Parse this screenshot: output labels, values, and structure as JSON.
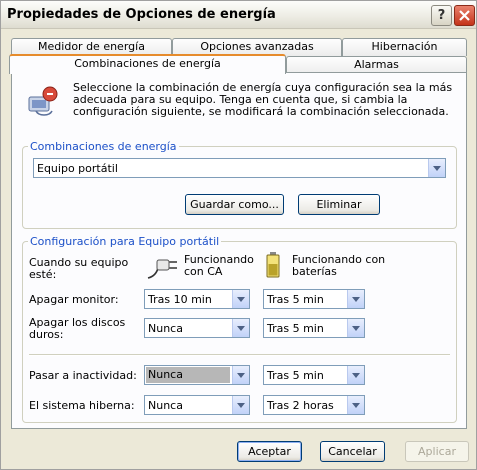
{
  "window": {
    "title": "Propiedades de Opciones de energía",
    "help_label": "?"
  },
  "tabs": {
    "row_top": [
      "Medidor de energía",
      "Opciones avanzadas",
      "Hibernación"
    ],
    "row_bottom": [
      "Combinaciones de energía",
      "Alarmas"
    ],
    "active": "Combinaciones de energía"
  },
  "intro": {
    "icon": "power-schemes-icon",
    "text": "Seleccione la combinación de energía  cuya configuración sea la más adecuada para su equipo. Tenga en cuenta que, si cambia la configuración siguiente, se modificará la combinación seleccionada."
  },
  "schemes": {
    "group_title": "Combinaciones de energía",
    "selected": "Equipo portátil",
    "save_as_label": "Guardar como...",
    "delete_label": "Eliminar"
  },
  "settings": {
    "group_title": "Configuración para Equipo portátil",
    "when_label": "Cuando su equipo esté:",
    "ac_label": "Funcionando con CA",
    "battery_label": "Funcionando con baterías",
    "rows": [
      {
        "label": "Apagar monitor:",
        "ac": "Tras 10 min",
        "battery": "Tras 5 min"
      },
      {
        "label": "Apagar los discos duros:",
        "ac": "Nunca",
        "battery": "Tras 5 min"
      },
      {
        "label": "Pasar a inactividad:",
        "ac": "Nunca",
        "battery": "Tras 5 min"
      },
      {
        "label": "El sistema hiberna:",
        "ac": "Nunca",
        "battery": "Tras 2 horas"
      }
    ]
  },
  "footer": {
    "ok_label": "Aceptar",
    "cancel_label": "Cancelar",
    "apply_label": "Aplicar"
  },
  "colors": {
    "accent": "#1c50c8",
    "tab_highlight": "#e68b2c",
    "close": "#c4331a"
  }
}
